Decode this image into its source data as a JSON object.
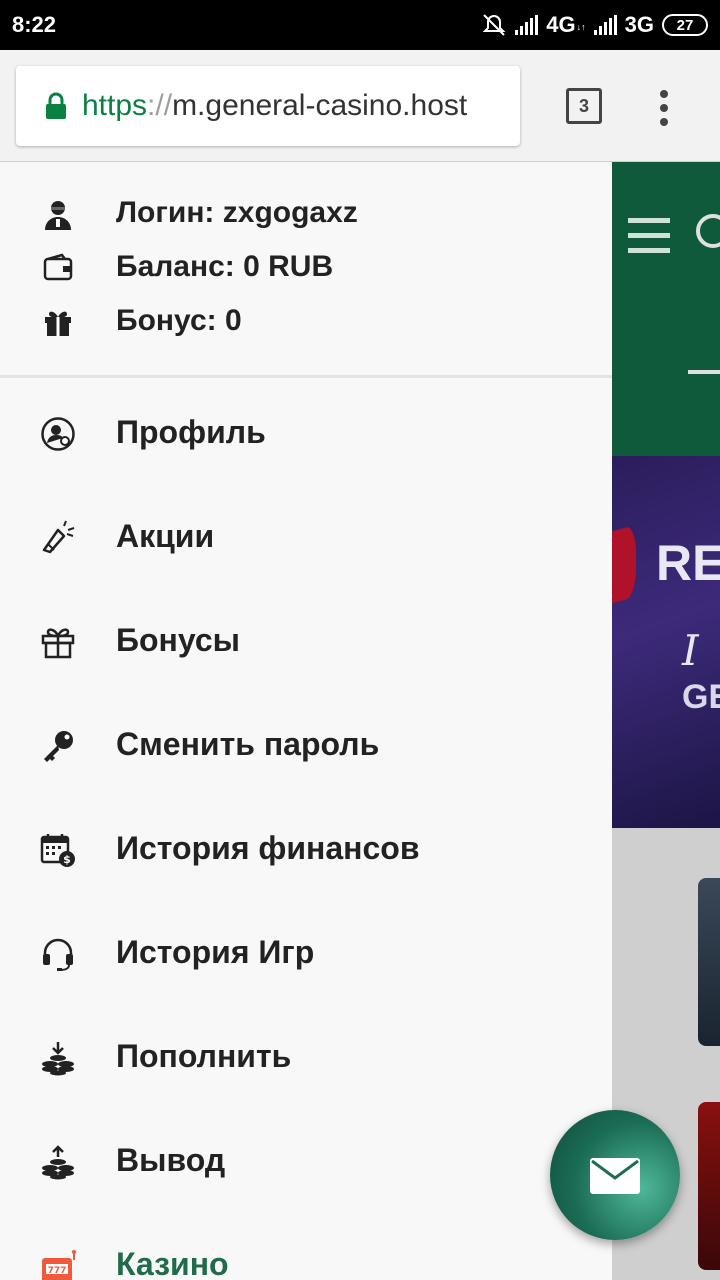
{
  "status_bar": {
    "time": "8:22",
    "network_1": "4G",
    "network_2": "3G",
    "battery": "27"
  },
  "browser": {
    "url_scheme": "https",
    "url_separator": "://",
    "url_host": "m.general-casino.host",
    "tab_count": "3"
  },
  "account": {
    "login": "Логин: zxgogaxz",
    "balance": "Баланс: 0 RUB",
    "bonus": "Бонус: 0"
  },
  "menu": [
    {
      "label": "Профиль",
      "icon": "profile-icon"
    },
    {
      "label": "Акции",
      "icon": "megaphone-icon"
    },
    {
      "label": "Бонусы",
      "icon": "gift-icon"
    },
    {
      "label": "Сменить пароль",
      "icon": "key-icon"
    },
    {
      "label": "История финансов",
      "icon": "calendar-dollar-icon"
    },
    {
      "label": "История Игр",
      "icon": "headset-icon"
    },
    {
      "label": "Пополнить",
      "icon": "coins-deposit-icon"
    },
    {
      "label": "Вывод",
      "icon": "coins-withdraw-icon"
    },
    {
      "label": "Казино",
      "icon": "slot-machine-icon",
      "active": true
    }
  ],
  "background_page": {
    "banner_text_1": "RE",
    "banner_text_2": "I",
    "banner_text_3": "GE"
  },
  "colors": {
    "brand_green": "#0e5a3b",
    "active_item": "#1f6b4a",
    "url_green": "#0b8043",
    "fab": "#1b6d55"
  }
}
